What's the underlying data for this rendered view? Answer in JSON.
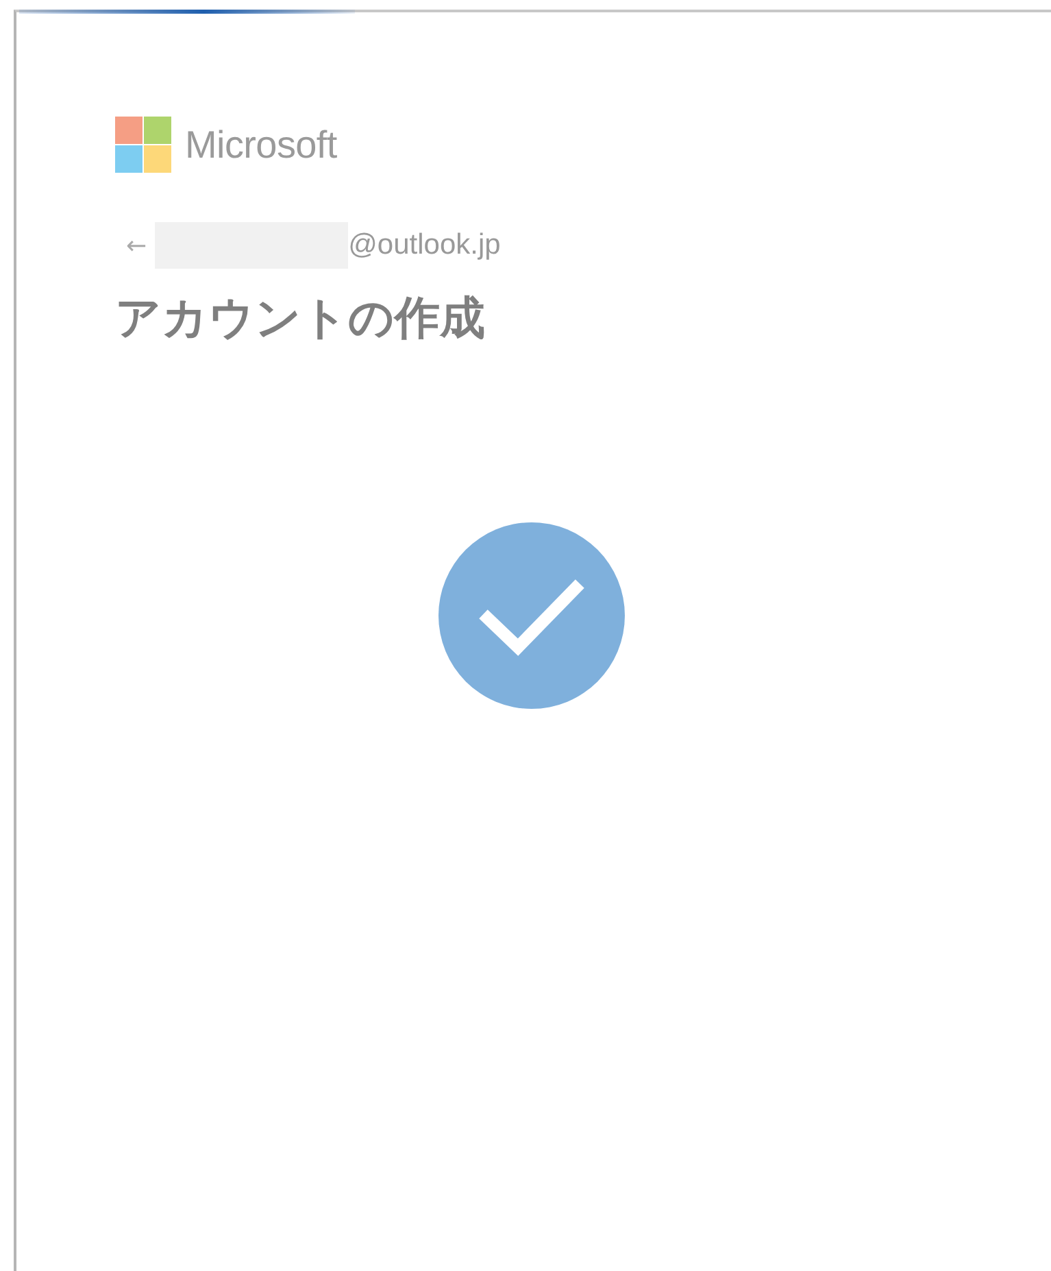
{
  "progress": {
    "kind": "indeterminate"
  },
  "brand": {
    "name": "Microsoft"
  },
  "identity": {
    "back": "←",
    "masked": true,
    "email": "@outlook.jp"
  },
  "title": "アカウントの作成",
  "status": {
    "kind": "success"
  }
}
